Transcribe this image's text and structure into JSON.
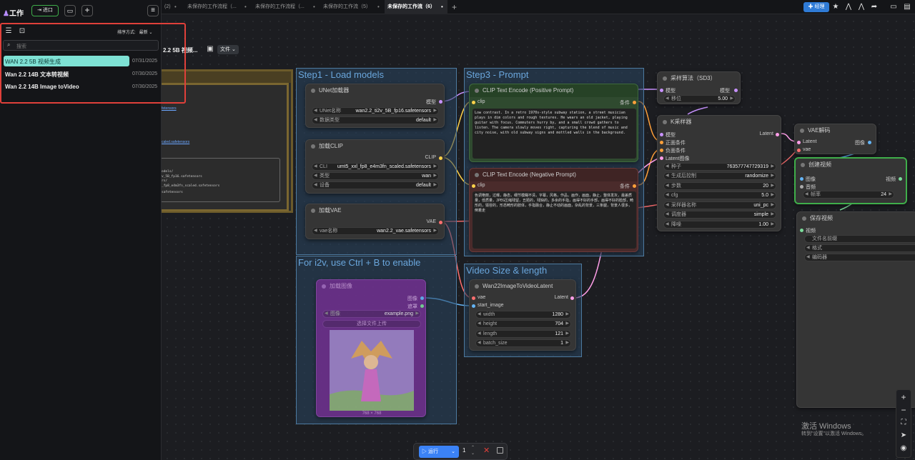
{
  "sidebar": {
    "title": "工作",
    "import_label": "进口",
    "sort_label": "排序方式:",
    "sort_value": "最新",
    "search_placeholder": "搜索",
    "items": [
      {
        "name": "WAN 2.2 5B 视频生成",
        "date": "07/31/2025"
      },
      {
        "name": "Wan 2.2 14B 文本转视频",
        "date": "07/30/2025"
      },
      {
        "name": "Wan 2.2 14B Image toVideo",
        "date": "07/30/2025"
      }
    ]
  },
  "tabs": [
    {
      "label": "(2)"
    },
    {
      "label": "未保存的工作流程（..."
    },
    {
      "label": "未保存的工作流程（..."
    },
    {
      "label": "未保存的工作流（5）"
    },
    {
      "label": "未保存的工作流（6）"
    }
  ],
  "topright": {
    "manager_label": "经理"
  },
  "workflow": {
    "name_fragment": "2.2 5B 视频...",
    "file_menu": "文件"
  },
  "hidden_node_text": {
    "link1": "fetensors",
    "link2": "caled.safetensors",
    "lines": [
      "odels/",
      "v_5B_fp16.safetensors",
      "rs/",
      "_fp8_e4m3fn_scaled.safetensors",
      "safetensors"
    ]
  },
  "groups": {
    "g1": "Step1 - Load models",
    "g3": "Step3 - Prompt",
    "gi2v": "For i2v, use Ctrl + B to enable",
    "gvs": "Video Size & length"
  },
  "nodes": {
    "unet": {
      "title": "UNet加载器",
      "out": "模型",
      "w1_label": "UNet名称",
      "w1_value": "wan2.2_ti2v_5B_fp16.safetensors",
      "w2_label": "数据类型",
      "w2_value": "default"
    },
    "clip": {
      "title": "加载CLIP",
      "out": "CLIP",
      "w1_label": "CLI",
      "w1_value": "umt5_xxl_fp8_e4m3fn_scaled.safetensors",
      "w2_label": "类型",
      "w2_value": "wan",
      "w3_label": "设备",
      "w3_value": "default"
    },
    "vae": {
      "title": "加载VAE",
      "out": "VAE",
      "w1_label": "vae名称",
      "w1_value": "wan2.2_vae.safetensors"
    },
    "loadimg": {
      "title": "加载图像",
      "out1": "图像",
      "out2": "遮罩",
      "w1_label": "图像",
      "w1_value": "example.png",
      "upload": "选择文件上传",
      "dims": "768 × 768"
    },
    "pos": {
      "title": "CLIP Text Encode (Positive Prompt)",
      "in": "clip",
      "out": "条件",
      "text": "Low contrast. In a retro 1970s-style subway station, a street musician plays in dim colors and rough textures. He wears an old jacket, playing guitar with focus. Commuters hurry by, and a small crowd gathers to listen. The camera slowly moves right, capturing the blend of music and city noise, with old subway signs and mottled walls in the background."
    },
    "neg": {
      "title": "CLIP Text Encode (Negative Prompt)",
      "in": "clip",
      "out": "条件",
      "text": "色调艳丽，过曝，静态，细节模糊不清，字幕，风格，作品，画作，画面，静止，整体发灰，最差质量，低质量，JPEG压缩残留，丑陋的，残缺的，多余的手指，画得不好的手部，画得不好的脸部，畸形的，毁容的，形态畸形的肢体，手指融合，静止不动的画面，杂乱的背景，三条腿，背景人很多，倒着走"
    },
    "sampling": {
      "title": "采样算法（SD3）",
      "in": "模型",
      "out": "模型",
      "w1_label": "移位",
      "w1_value": "5.00"
    },
    "ksampler": {
      "title": "K采样器",
      "ins": [
        "模型",
        "正面条件",
        "负面条件",
        "Latent图像"
      ],
      "out": "Latent",
      "widgets": [
        {
          "label": "种子",
          "value": "763577747729319"
        },
        {
          "label": "生成后控制",
          "value": "randomize"
        },
        {
          "label": "步数",
          "value": "20"
        },
        {
          "label": "cfg",
          "value": "5.0"
        },
        {
          "label": "采样器名称",
          "value": "uni_pc"
        },
        {
          "label": "调度器",
          "value": "simple"
        },
        {
          "label": "降噪",
          "value": "1.00"
        }
      ]
    },
    "vaedecode": {
      "title": "VAE解码",
      "in1": "Latent",
      "in2": "vae",
      "out": "图像"
    },
    "createvideo": {
      "title": "创建视频",
      "in1": "图像",
      "in2": "音频",
      "out": "视频",
      "w1_label": "帧率",
      "w1_value": "24"
    },
    "savevideo": {
      "title": "保存视频",
      "in": "视频",
      "w1": "文件名前缀",
      "w2": "格式",
      "w3": "编码器"
    },
    "wanlatent": {
      "title": "Wan22ImageToVideoLatent",
      "in1": "vae",
      "in2": "start_image",
      "out": "Latent",
      "widgets": [
        {
          "label": "width",
          "value": "1280"
        },
        {
          "label": "height",
          "value": "704"
        },
        {
          "label": "length",
          "value": "121"
        },
        {
          "label": "batch_size",
          "value": "1"
        }
      ]
    }
  },
  "bottombar": {
    "run_label": "运行",
    "count": "1"
  },
  "watermark": {
    "line1": "激活 Windows",
    "line2": "转到\"设置\"以激活 Windows。"
  }
}
